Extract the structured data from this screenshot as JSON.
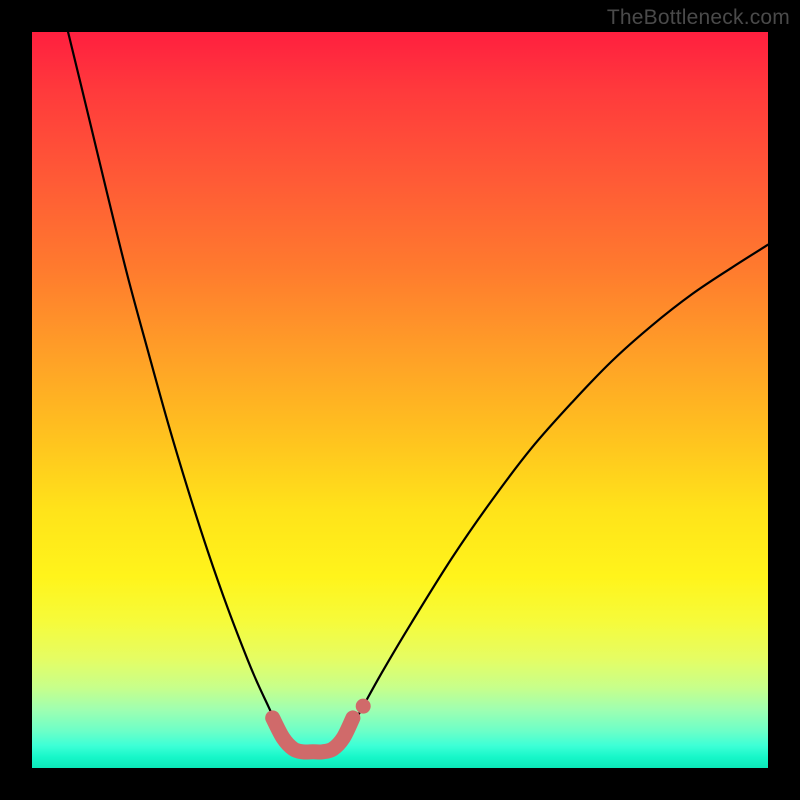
{
  "watermark": "TheBottleneck.com",
  "colors": {
    "frame": "#000000",
    "curve_stroke": "#000000",
    "highlight_stroke": "#d06a6a",
    "highlight_fill": "#d06a6a"
  },
  "chart_data": {
    "type": "line",
    "title": "",
    "xlabel": "",
    "ylabel": "",
    "xlim": [
      0,
      100
    ],
    "ylim": [
      0,
      100
    ],
    "grid": false,
    "legend": false,
    "note": "Values estimated from pixel positions; y is percent of plot height from bottom, x is percent of plot width from left.",
    "series": [
      {
        "name": "left_curve",
        "x": [
          4.9,
          7.6,
          10.3,
          13.0,
          15.8,
          18.5,
          21.2,
          23.9,
          26.6,
          29.3,
          30.7,
          32.1,
          33.4,
          34.2,
          34.8
        ],
        "y": [
          100.0,
          88.9,
          77.7,
          66.8,
          56.5,
          46.8,
          37.8,
          29.4,
          21.7,
          14.7,
          11.4,
          8.4,
          5.6,
          4.1,
          3.3
        ]
      },
      {
        "name": "right_curve",
        "x": [
          41.8,
          42.5,
          43.5,
          45.0,
          47.5,
          51.6,
          57.1,
          62.5,
          67.9,
          73.4,
          78.8,
          84.2,
          89.7,
          95.1,
          100.0
        ],
        "y": [
          3.3,
          4.1,
          5.7,
          8.4,
          12.9,
          19.8,
          28.6,
          36.4,
          43.5,
          49.7,
          55.3,
          60.1,
          64.4,
          68.0,
          71.1
        ]
      },
      {
        "name": "valley_highlight_band",
        "x": [
          32.7,
          34.1,
          35.5,
          36.8,
          38.2,
          39.5,
          40.9,
          42.3,
          43.6
        ],
        "y": [
          6.8,
          4.1,
          2.6,
          2.2,
          2.2,
          2.2,
          2.6,
          4.1,
          6.8
        ]
      }
    ],
    "highlight_marker": {
      "x": 45.0,
      "y": 8.4
    }
  }
}
